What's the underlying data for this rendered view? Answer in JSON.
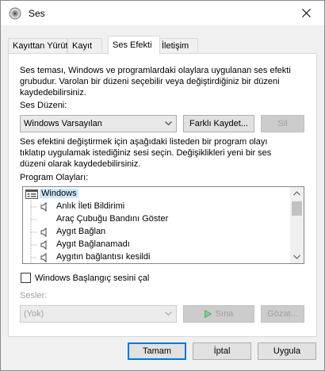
{
  "window": {
    "title": "Ses"
  },
  "tabs": [
    {
      "label": "Kayıttan Yürüt"
    },
    {
      "label": "Kayıt"
    },
    {
      "label": "Ses Efekti"
    },
    {
      "label": "İletişim"
    }
  ],
  "sound_effects": {
    "intro": "Ses teması, Windows ve programlardaki olaylara uygulanan ses efekti grubudur. Varolan bir düzeni seçebilir veya değiştirdiğiniz bir düzeni kaydedebilirsiniz.",
    "intro_lines": [
      "Ses teması, Windows ve programlardaki olaylara uygulanan ses efekti",
      "grubudur. Varolan bir düzeni seçebilir veya değiştirdiğiniz bir düzeni",
      "kaydedebilirsiniz."
    ],
    "scheme_label": "Ses Düzeni:",
    "scheme_value": "Windows Varsayılan",
    "save_as_label": "Farklı Kaydet...",
    "delete_label": "Sil",
    "instructions_lines": [
      "Ses efektini değiştirmek için aşağıdaki listeden bir program olayı",
      "tıklatıp uygulamak istediğiniz sesi seçin. Değişiklikleri yeni bir ses",
      "düzeni olarak kaydedebilirsiniz."
    ],
    "events_label": "Program Olayları:",
    "events": [
      {
        "label": "Windows",
        "kind": "group",
        "has_sound": false
      },
      {
        "label": "Anlık İleti Bildirimi",
        "kind": "item",
        "has_sound": true
      },
      {
        "label": "Araç Çubuğu Bandını Göster",
        "kind": "item",
        "has_sound": false
      },
      {
        "label": "Aygıt Bağlan",
        "kind": "item",
        "has_sound": true
      },
      {
        "label": "Aygıt Bağlanamadı",
        "kind": "item",
        "has_sound": true
      },
      {
        "label": "Aygıtın bağlantısı kesildi",
        "kind": "item",
        "has_sound": true
      }
    ],
    "startup_checkbox_label": "Windows Başlangıç sesini çal",
    "startup_checked": false,
    "sounds_label": "Sesler:",
    "sounds_value": "(Yok)",
    "test_label": "Sına",
    "browse_label": "Gözat..."
  },
  "footer": {
    "ok_label": "Tamam",
    "cancel_label": "İptal",
    "apply_label": "Uygula"
  },
  "colors": {
    "accent": "#0078d7",
    "selection": "#cce8ff",
    "play_green": "#3cb043"
  }
}
